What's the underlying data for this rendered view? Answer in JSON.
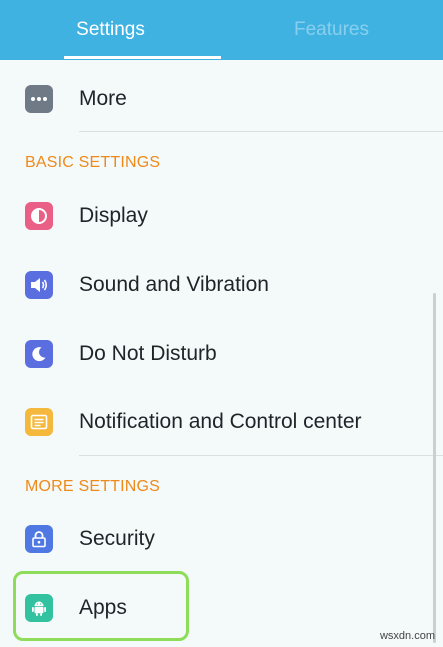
{
  "tabs": {
    "settings": "Settings",
    "features": "Features"
  },
  "sections": {
    "basic": "BASIC SETTINGS",
    "more": "MORE SETTINGS"
  },
  "items": {
    "more": "More",
    "display": "Display",
    "sound": "Sound and Vibration",
    "dnd": "Do Not Disturb",
    "notification": "Notification and Control center",
    "security": "Security",
    "apps": "Apps"
  },
  "watermark": "wsxdn.com",
  "colors": {
    "header": "#3fb2e2",
    "section_header": "#ee8a1a",
    "more_icon": "#6f7a86",
    "display_icon": "#ea5f86",
    "sound_icon": "#5a6ee0",
    "dnd_icon": "#5a6ee0",
    "notification_icon": "#f4b83c",
    "security_icon": "#4f78e2",
    "apps_icon": "#33c2a0",
    "highlight": "#8ddc5a"
  },
  "icons": {
    "more": "more-dots-icon",
    "display": "display-contrast-icon",
    "sound": "speaker-icon",
    "dnd": "moon-icon",
    "notification": "notification-panel-icon",
    "security": "lock-icon",
    "apps": "android-icon"
  }
}
